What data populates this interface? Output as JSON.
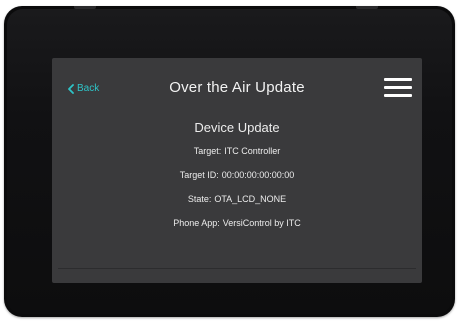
{
  "screen": {
    "back_label": "Back",
    "title": "Over the Air Update",
    "menu_icon": "hamburger-menu-icon",
    "accent_color": "#2ec4c8",
    "background_color": "#3a3a3c"
  },
  "content": {
    "heading": "Device Update",
    "fields": [
      {
        "label": "Target:",
        "value": "ITC Controller"
      },
      {
        "label": "Target ID:",
        "value": "00:00:00:00:00:00"
      },
      {
        "label": "State:",
        "value": "OTA_LCD_NONE"
      },
      {
        "label": "Phone App:",
        "value": "VersiControl by ITC"
      }
    ]
  }
}
